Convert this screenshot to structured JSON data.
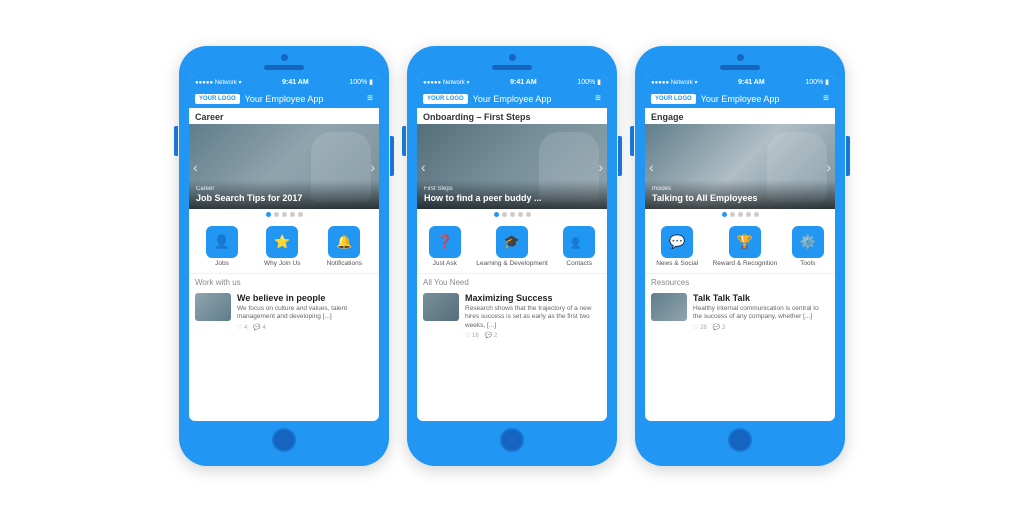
{
  "phones": [
    {
      "id": "career",
      "statusBar": {
        "signal": "●●●●● Network",
        "wifi": "▾",
        "time": "9:41 AM",
        "battery": "100%"
      },
      "header": {
        "logo": "YOUR LOGO",
        "title": "Your Employee App"
      },
      "sectionHeader": "Career",
      "hero": {
        "category": "Career",
        "title": "Job Search Tips for 2017",
        "imgClass": "hero-img-career"
      },
      "dots": [
        true,
        false,
        false,
        false,
        false
      ],
      "quickActions": [
        {
          "icon": "👤",
          "label": "Jobs"
        },
        {
          "icon": "⭐",
          "label": "Why Join Us"
        },
        {
          "icon": "🔔",
          "label": "Notifications"
        }
      ],
      "contentSectionTitle": "Work with us",
      "contentCard": {
        "title": "We believe in people",
        "text": "We focus on culture and values, talent management and developing [...]",
        "imgClass": "img-placeholder-1",
        "likes": "♡ 4",
        "comments": "💬 4"
      }
    },
    {
      "id": "onboarding",
      "statusBar": {
        "signal": "●●●●● Network",
        "wifi": "▾",
        "time": "9:41 AM",
        "battery": "100%"
      },
      "header": {
        "logo": "YOUR LOGO",
        "title": "Your Employee App"
      },
      "sectionHeader": "Onboarding – First Steps",
      "hero": {
        "category": "First Steps",
        "title": "How to find a peer buddy ...",
        "imgClass": "hero-img-onboarding"
      },
      "dots": [
        true,
        false,
        false,
        false,
        false
      ],
      "quickActions": [
        {
          "icon": "❓",
          "label": "Just Ask"
        },
        {
          "icon": "🎓",
          "label": "Learning & Development"
        },
        {
          "icon": "👥",
          "label": "Contacts"
        }
      ],
      "contentSectionTitle": "All You Need",
      "contentCard": {
        "title": "Maximizing Success",
        "text": "Research shows that the trajectory of a new hires success is set as early as the first two weeks, [...]",
        "imgClass": "img-placeholder-2",
        "likes": "♡ 16",
        "comments": "💬 2"
      }
    },
    {
      "id": "engage",
      "statusBar": {
        "signal": "●●●●● Network",
        "wifi": "▾",
        "time": "9:41 AM",
        "battery": "100%"
      },
      "header": {
        "logo": "YOUR LOGO",
        "title": "Your Employee App"
      },
      "sectionHeader": "Engage",
      "hero": {
        "category": "Insides",
        "title": "Talking to All Employees",
        "imgClass": "hero-img-engage"
      },
      "dots": [
        true,
        false,
        false,
        false,
        false
      ],
      "quickActions": [
        {
          "icon": "💬",
          "label": "News & Social"
        },
        {
          "icon": "🏆",
          "label": "Reward & Recognition"
        },
        {
          "icon": "⚙️",
          "label": "Tools"
        }
      ],
      "contentSectionTitle": "Resources",
      "contentCard": {
        "title": "Talk Talk Talk",
        "text": "Healthy internal communication is central to the success of any company, whether [...]",
        "imgClass": "img-placeholder-3",
        "likes": "♡ 28",
        "comments": "💬 3"
      }
    }
  ]
}
